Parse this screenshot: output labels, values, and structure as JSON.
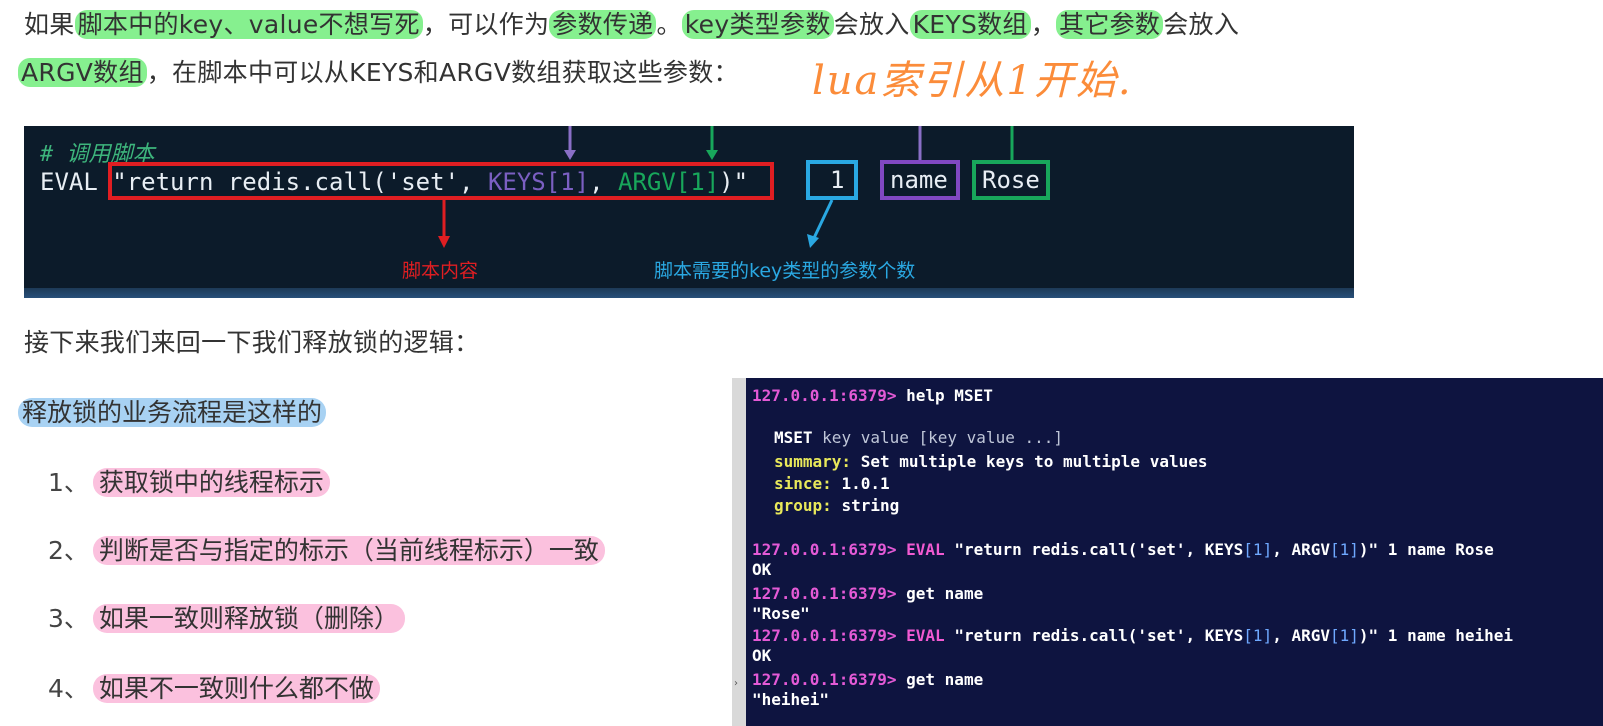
{
  "intro": {
    "line1": [
      {
        "t": "如果",
        "hl": ""
      },
      {
        "t": "脚本中的key、value不想写死",
        "hl": "green"
      },
      {
        "t": "，可以作为",
        "hl": ""
      },
      {
        "t": "参数传递",
        "hl": "green"
      },
      {
        "t": "。",
        "hl": ""
      },
      {
        "t": "key类型参数",
        "hl": "green"
      },
      {
        "t": "会放入",
        "hl": ""
      },
      {
        "t": "KEYS数组",
        "hl": "green"
      },
      {
        "t": "，",
        "hl": ""
      },
      {
        "t": "其它参数",
        "hl": "green"
      },
      {
        "t": "会放入",
        "hl": ""
      }
    ],
    "line2": [
      {
        "t": "ARGV数组",
        "hl": "green"
      },
      {
        "t": "，在脚本中可以从KEYS和ARGV数组获取这些参数：",
        "hl": ""
      }
    ],
    "handwritten_note": "lua索引从1开始."
  },
  "code_banner": {
    "comment": "#  调用脚本",
    "eval": "EVAL",
    "script_prefix": "\"return redis.call('set', ",
    "keys_ref": "KEYS[1]",
    "comma": ", ",
    "argv_ref": "ARGV[1]",
    "script_suffix": ")\"",
    "numkeys": "1",
    "key_arg": "name",
    "value_arg": "Rose",
    "label_script": "脚本内容",
    "label_numkeys": "脚本需要的key类型的参数个数"
  },
  "section": {
    "recap": "接下来我们来回一下我们释放锁的逻辑：",
    "flow_title": "释放锁的业务流程是这样的",
    "steps": [
      {
        "num": "1、",
        "text": "获取锁中的线程标示"
      },
      {
        "num": "2、",
        "text": "判断是否与指定的标示（当前线程标示）一致"
      },
      {
        "num": "3、",
        "text": "如果一致则释放锁（删除）"
      },
      {
        "num": "4、",
        "text": "如果不一致则什么都不做"
      }
    ]
  },
  "terminal": {
    "prompt": "127.0.0.1:6379>",
    "help_cmd": "help MSET",
    "help_sig_cmd": "MSET",
    "help_sig_args": "key value [key value ...]",
    "summary_label": "summary:",
    "summary_text": "Set multiple keys to multiple values",
    "since_label": "since:",
    "since_text": "1.0.1",
    "group_label": "group:",
    "group_text": "string",
    "eval_kw": "EVAL",
    "eval1_a": "\"return redis.call('set', KEYS",
    "idx": "[1]",
    "eval_mid": ", ARGV",
    "eval1_end": ")\" 1 name Rose",
    "ok": "OK",
    "get_cmd": "get name",
    "result1": "\"Rose\"",
    "eval2_end": ")\" 1 name heihei",
    "result2": "\"heihei\""
  },
  "colors": {
    "highlight_green": "#86f08f",
    "highlight_blue": "#a8d2f3",
    "highlight_pink": "#fbc1de",
    "box_red": "#e01e22",
    "box_blue": "#2aa8e2",
    "box_purple": "#8148c2",
    "box_green": "#18a75b",
    "note_orange": "#fb8c3a"
  }
}
